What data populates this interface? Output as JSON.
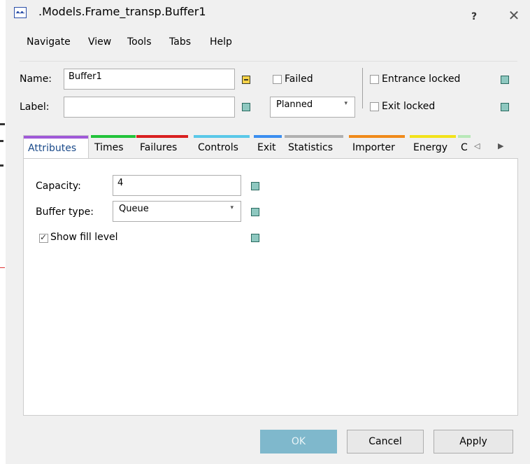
{
  "window": {
    "title": ".Models.Frame_transp.Buffer1",
    "help": "?",
    "close": "✕"
  },
  "menu": [
    "Navigate",
    "View",
    "Tools",
    "Tabs",
    "Help"
  ],
  "header": {
    "name_label": "Name:",
    "name_value": "Buffer1",
    "label_label": "Label:",
    "label_value": "",
    "failed_label": "Failed",
    "planned_value": "Planned",
    "entrance_locked_label": "Entrance locked",
    "exit_locked_label": "Exit locked"
  },
  "tabs": [
    {
      "label": "Attributes",
      "color": "#a05ad8",
      "active": true
    },
    {
      "label": "Times",
      "color": "#22c33a"
    },
    {
      "label": "Failures",
      "color": "#d92020"
    },
    {
      "label": "Controls",
      "color": "#5ac8e8"
    },
    {
      "label": "Exit",
      "color": "#3b8ef0"
    },
    {
      "label": "Statistics",
      "color": "#b0b0b0"
    },
    {
      "label": "Importer",
      "color": "#f08a1a"
    },
    {
      "label": "Energy",
      "color": "#f2e21a"
    },
    {
      "label": "C",
      "color": "#b8e8b8"
    }
  ],
  "tab_scroll": {
    "left": "◁",
    "right": "▶"
  },
  "attributes": {
    "capacity_label": "Capacity:",
    "capacity_value": "4",
    "buffer_type_label": "Buffer type:",
    "buffer_type_value": "Queue",
    "show_fill_level_label": "Show fill level",
    "show_fill_level_checked": true
  },
  "buttons": {
    "ok": "OK",
    "cancel": "Cancel",
    "apply": "Apply"
  }
}
